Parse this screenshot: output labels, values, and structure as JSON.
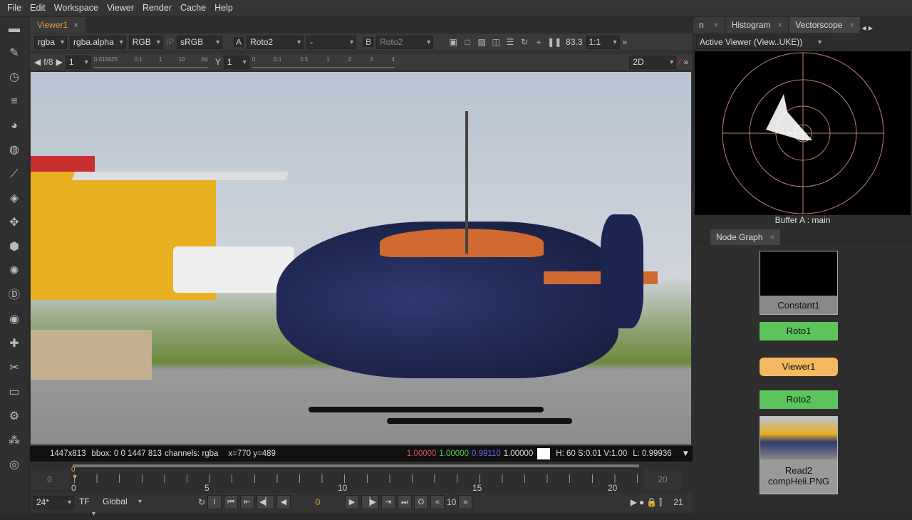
{
  "menu": [
    "File",
    "Edit",
    "Workspace",
    "Viewer",
    "Render",
    "Cache",
    "Help"
  ],
  "viewer": {
    "tab": "Viewer1",
    "toolbar": {
      "channels": "rgba",
      "alpha": "rgba.alpha",
      "display": "RGB",
      "ip": "IP",
      "lut": "sRGB",
      "a_label": "A",
      "a_input": "Roto2",
      "op": "-",
      "b_label": "B",
      "b_input": "Roto2",
      "zoom": "83.3",
      "ratio": "1:1"
    },
    "row2": {
      "fstop": "f/8",
      "gain": "1",
      "gain_ticks": [
        "0.015625",
        "0.1",
        "1",
        "10",
        "64"
      ],
      "y_label": "Y",
      "gamma": "1",
      "gamma_ticks": [
        "0",
        "0.1",
        "0.5",
        "1",
        "2",
        "3",
        "4"
      ],
      "mode": "2D"
    },
    "status": {
      "format": "1447x813",
      "bbox": "bbox: 0 0 1447 813",
      "channels": "channels: rgba",
      "coords": "x=770 y=489",
      "r": "1.00000",
      "g": "1.00000",
      "b": "0.99110",
      "a": "1.00000",
      "hsv": "H: 60 S:0.01 V:1.00",
      "l": "L: 0.99936"
    },
    "timeline": {
      "start": "0",
      "end": "20",
      "current": "0",
      "ticks": [
        "0",
        "5",
        "10",
        "15",
        "20"
      ]
    },
    "controls": {
      "fps": "24*",
      "tf": "TF",
      "global": "Global",
      "in": "I",
      "frame": "0",
      "out": "O",
      "step": "10",
      "last": "21"
    }
  },
  "right": {
    "tabs": [
      "n",
      "Histogram",
      "Vectorscope"
    ],
    "viewer_select": "Active Viewer (View..UKE))",
    "buffer": "Buffer A : main",
    "node_graph_tab": "Node Graph",
    "nodes": [
      "Constant1",
      "Roto1",
      "Viewer1",
      "Roto2",
      "Read2",
      "compHeli.PNG"
    ]
  },
  "colors": {
    "accent": "#e8a040",
    "roto": "#5cc45c",
    "viewer_node": "#f4b860"
  }
}
